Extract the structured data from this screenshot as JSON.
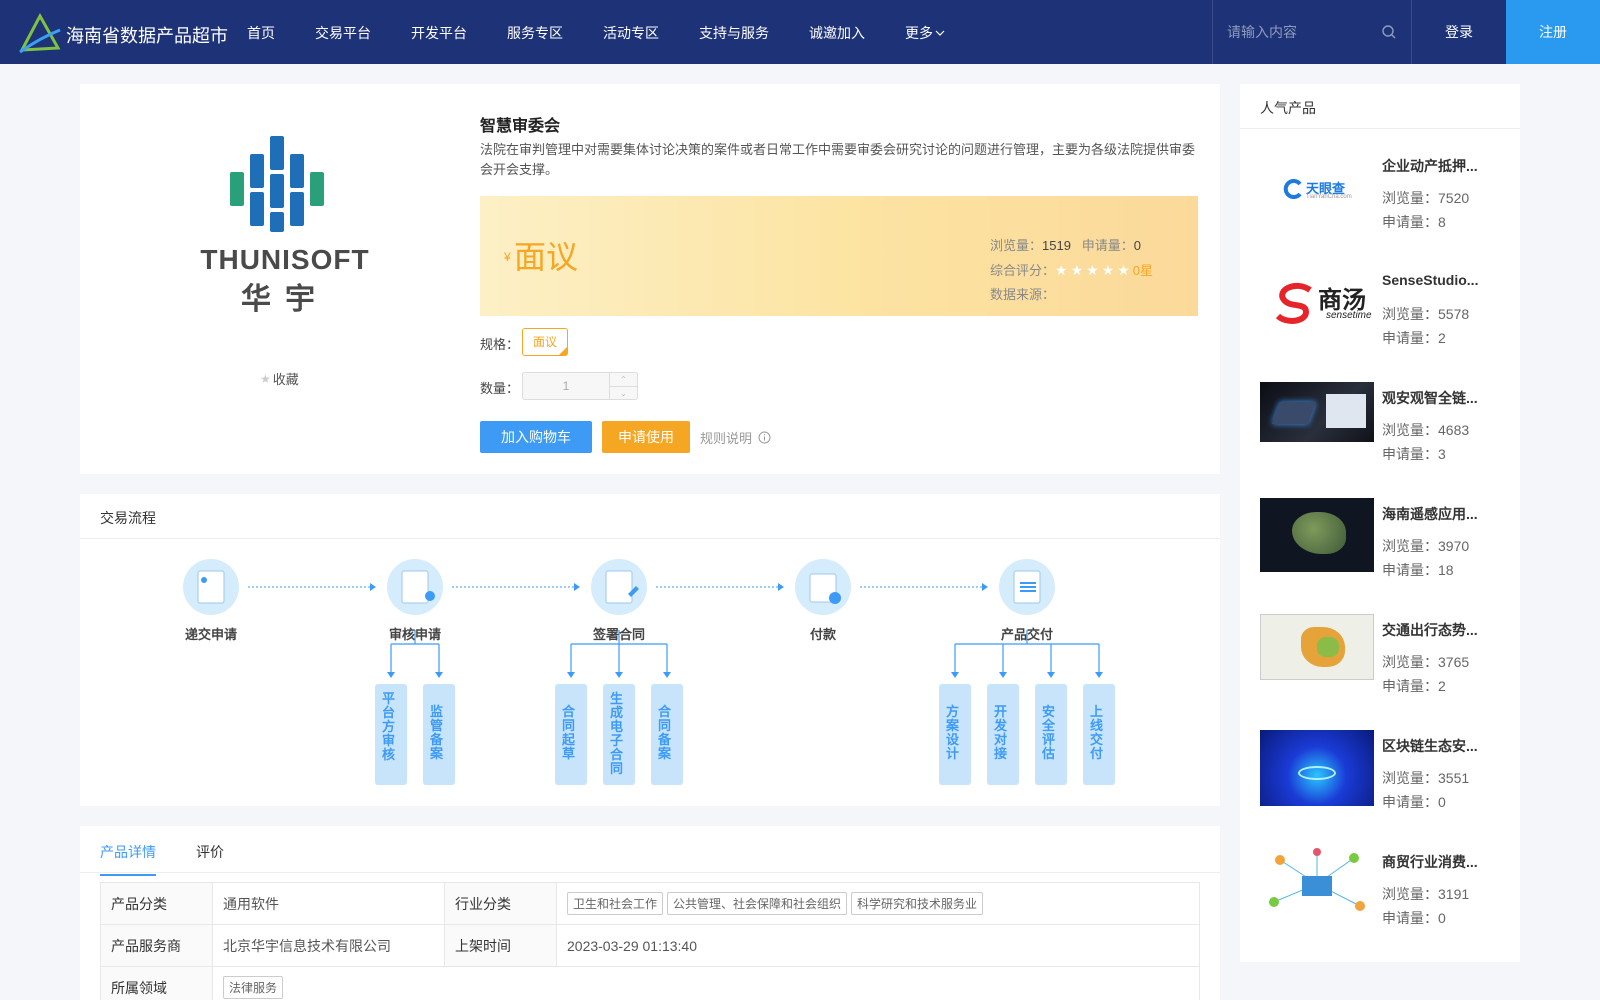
{
  "header": {
    "brand": "海南省数据产品超市",
    "nav": [
      "首页",
      "交易平台",
      "开发平台",
      "服务专区",
      "活动专区",
      "支持与服务",
      "诚邀加入",
      "更多"
    ],
    "search_placeholder": "请输入内容",
    "login": "登录",
    "register": "注册",
    "colors": {
      "bg": "#1d3277",
      "register_bg": "#2a9af0"
    }
  },
  "product": {
    "logo_text_en": "THUNISOFT",
    "logo_text_cn": "华宇",
    "favorite": "收藏",
    "title": "智慧审委会",
    "description": "法院在审判管理中对需要集体讨论决策的案件或者日常工作中需要审委会研究讨论的问题进行管理，主要为各级法院提供审委会开会支撑。",
    "yen": "¥",
    "price": "面议",
    "views_label": "浏览量：",
    "views": "1519",
    "apps_label": "申请量：",
    "apps": "0",
    "rating_label": "综合评分：",
    "rating_text": "0星",
    "rating_value": 0,
    "source_label": "数据来源：",
    "spec_label": "规格：",
    "spec_value": "面议",
    "qty_label": "数量：",
    "qty_value": "1",
    "add_cart": "加入购物车",
    "apply": "申请使用",
    "rules": "规则说明",
    "accent": "#f5a623"
  },
  "flow": {
    "title": "交易流程",
    "steps": [
      "递交申请",
      "审核申请",
      "签署合同",
      "付款",
      "产品交付"
    ],
    "sub": {
      "review": [
        "平台方审核",
        "监管备案"
      ],
      "contract": [
        "合同起草",
        "生成电子合同",
        "合同备案"
      ],
      "deliver": [
        "方案设计",
        "开发对接",
        "安全评估",
        "上线交付"
      ]
    }
  },
  "tabs": {
    "items": [
      "产品详情",
      "评价"
    ],
    "rows": {
      "category_label": "产品分类",
      "category": "通用软件",
      "industry_label": "行业分类",
      "industries": [
        "卫生和社会工作",
        "公共管理、社会保障和社会组织",
        "科学研究和技术服务业"
      ],
      "provider_label": "产品服务商",
      "provider": "北京华宇信息技术有限公司",
      "time_label": "上架时间",
      "time": "2023-03-29 01:13:40",
      "domain_label": "所属领域",
      "domain": "法律服务"
    }
  },
  "side": {
    "title": "人气产品",
    "items": [
      {
        "name": "企业动产抵押...",
        "views": "浏览量：7520",
        "apps": "申请量：8",
        "img": "tianyancha-logo",
        "logo_text": "天眼查",
        "logo_sub": "TianYanCha.com"
      },
      {
        "name": "SenseStudio...",
        "views": "浏览量：5578",
        "apps": "申请量：2",
        "img": "sensetime-logo",
        "logo_text": "商汤",
        "logo_sub": "sensetime"
      },
      {
        "name": "观安观智全链...",
        "views": "浏览量：4683",
        "apps": "申请量：3",
        "img": "device-photo"
      },
      {
        "name": "海南遥感应用...",
        "views": "浏览量：3970",
        "apps": "申请量：18",
        "img": "satellite-map"
      },
      {
        "name": "交通出行态势...",
        "views": "浏览量：3765",
        "apps": "申请量：2",
        "img": "traffic-map"
      },
      {
        "name": "区块链生态安...",
        "views": "浏览量：3551",
        "apps": "申请量：0",
        "img": "blockchain-art"
      },
      {
        "name": "商贸行业消费...",
        "views": "浏览量：3191",
        "apps": "申请量：0",
        "img": "network-illustration"
      }
    ]
  }
}
